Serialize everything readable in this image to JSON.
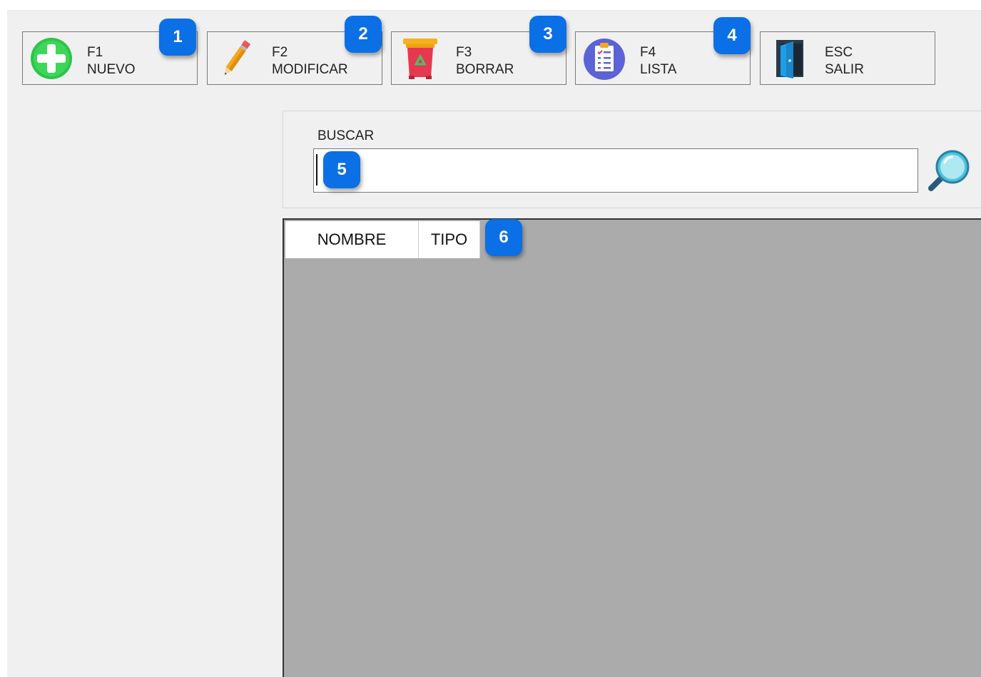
{
  "toolbar": {
    "buttons": [
      {
        "key": "F1",
        "label": "NUEVO",
        "icon": "add-circle-icon"
      },
      {
        "key": "F2",
        "label": "MODIFICAR",
        "icon": "pencil-icon"
      },
      {
        "key": "F3",
        "label": "BORRAR",
        "icon": "trash-bin-icon"
      },
      {
        "key": "F4",
        "label": "LISTA",
        "icon": "clipboard-list-icon"
      },
      {
        "key": "ESC",
        "label": "SALIR",
        "icon": "door-exit-icon"
      }
    ]
  },
  "badges": [
    "1",
    "2",
    "3",
    "4",
    "5",
    "6"
  ],
  "search": {
    "label": "BUSCAR",
    "value": "",
    "placeholder": ""
  },
  "grid": {
    "columns": [
      "NOMBRE",
      "TIPO"
    ]
  },
  "colors": {
    "badge": "#0b6fe6",
    "window_bg": "#f0f0f0",
    "grid_bg": "#ababab"
  }
}
